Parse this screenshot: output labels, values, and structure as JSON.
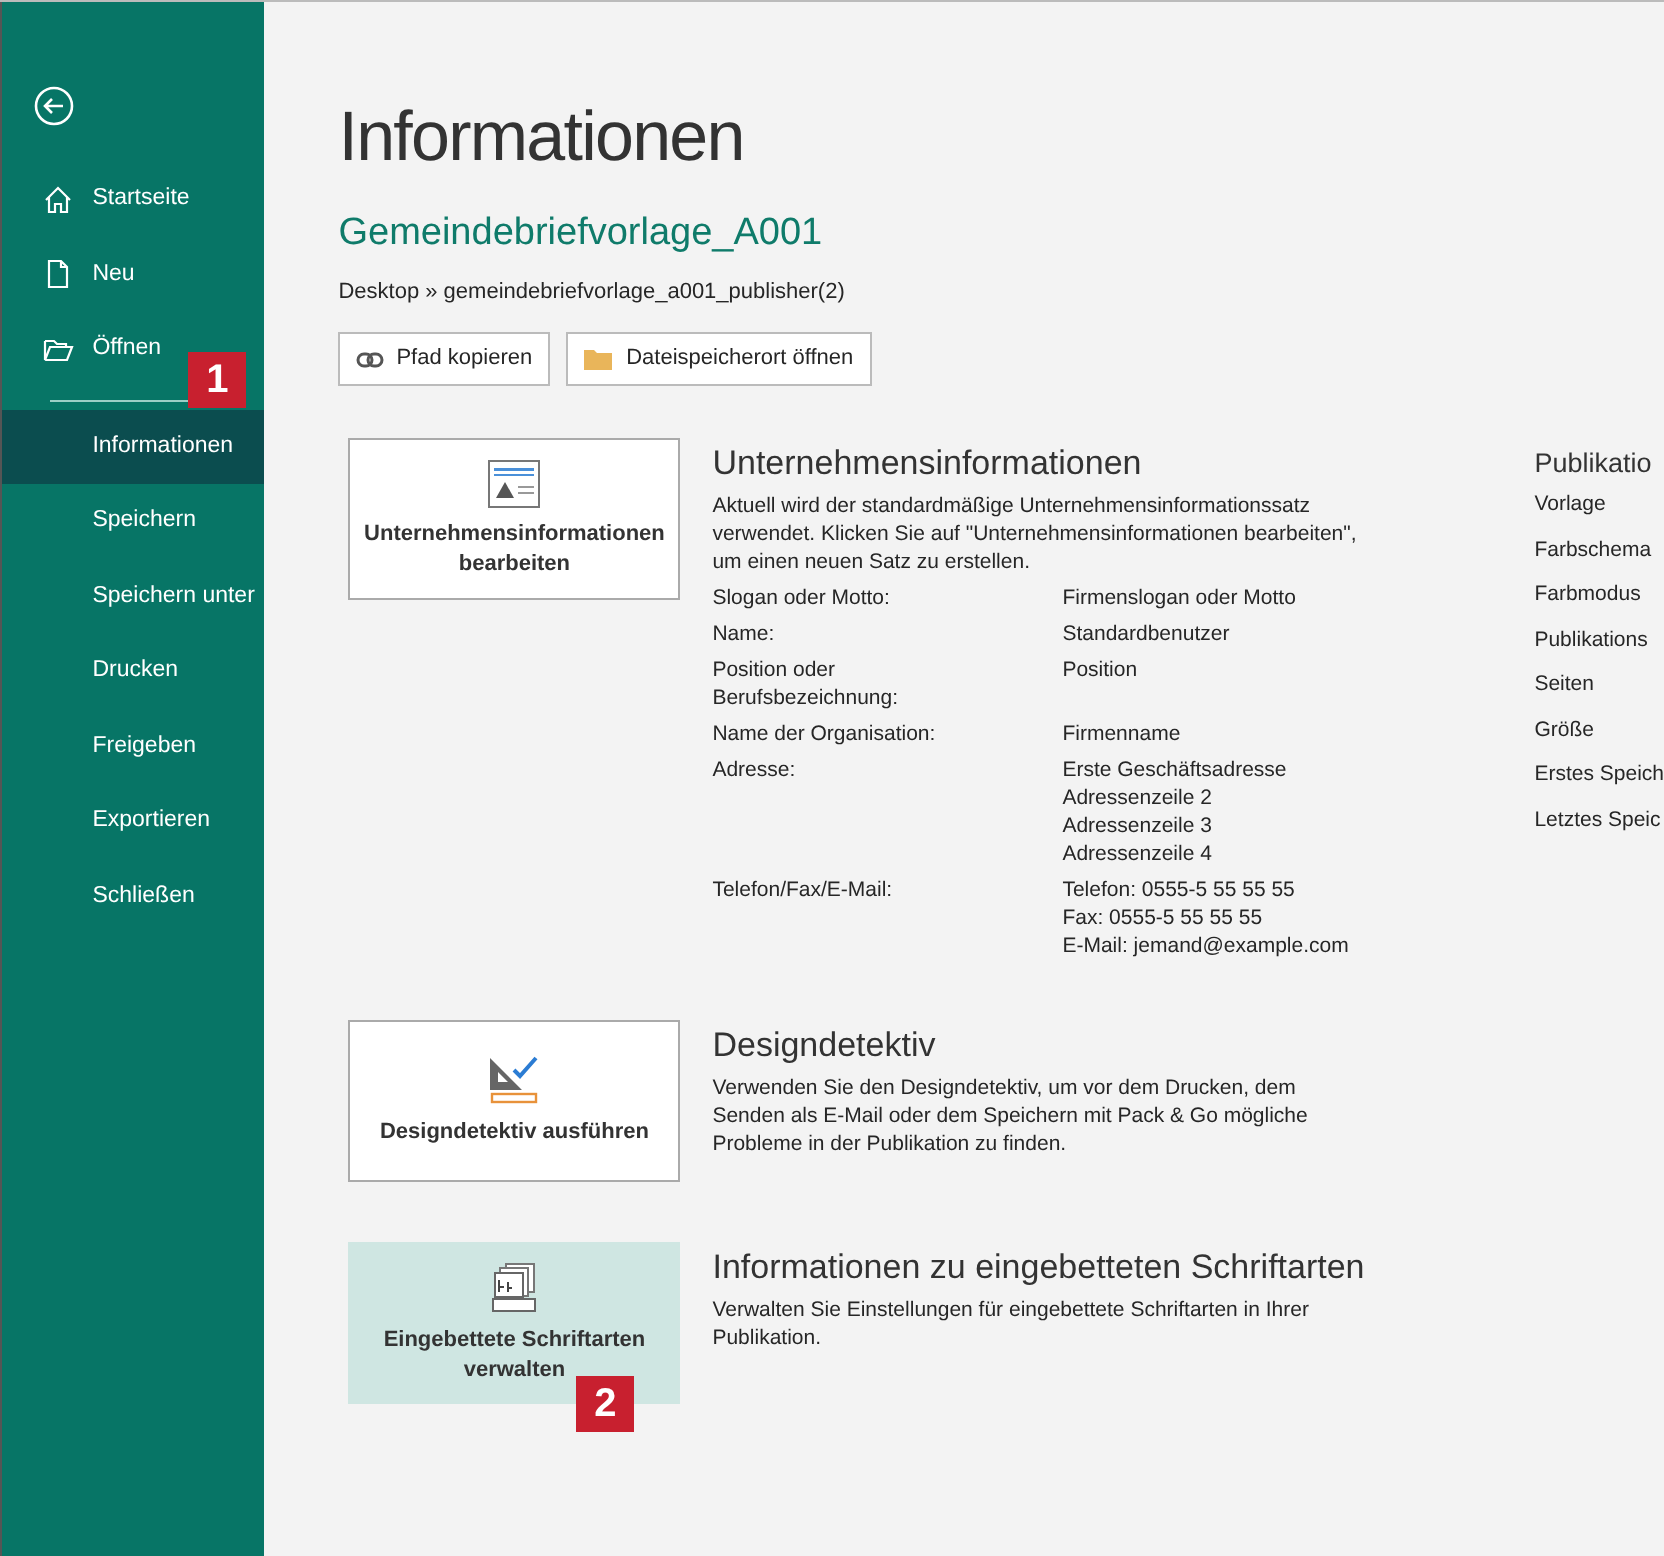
{
  "sidebar": {
    "items": [
      {
        "label": "Startseite",
        "selected": false
      },
      {
        "label": "Neu",
        "selected": false
      },
      {
        "label": "Öffnen",
        "selected": false
      },
      {
        "label": "Informationen",
        "selected": true,
        "badge": "1"
      },
      {
        "label": "Speichern",
        "selected": false
      },
      {
        "label": "Speichern unter",
        "selected": false
      },
      {
        "label": "Drucken",
        "selected": false
      },
      {
        "label": "Freigeben",
        "selected": false
      },
      {
        "label": "Exportieren",
        "selected": false
      },
      {
        "label": "Schließen",
        "selected": false
      }
    ]
  },
  "title": "Informationen",
  "document_name": "Gemeindebriefvorlage_A001",
  "path": "Desktop » gemeindebriefvorlage_a001_publisher(2)",
  "path_buttons": [
    {
      "label": "Pfad kopieren"
    },
    {
      "label": "Dateispeicherort öffnen"
    }
  ],
  "sections": [
    {
      "button": {
        "label": "Unternehmensinformationen bearbeiten",
        "highlighted": false
      },
      "heading": "Unternehmensinformationen",
      "description": "Aktuell wird der standardmäßige Unternehmensinformationssatz verwendet. Klicken Sie auf \"Unternehmensinformationen bearbeiten\", um einen neuen Satz zu erstellen.",
      "fields": [
        {
          "label": "Slogan oder Motto:",
          "values": [
            "Firmenslogan oder Motto"
          ]
        },
        {
          "label": "Name:",
          "values": [
            "Standardbenutzer"
          ]
        },
        {
          "label": "Position oder Berufsbezeichnung:",
          "values": [
            "Position"
          ]
        },
        {
          "label": "Name der Organisation:",
          "values": [
            "Firmenname"
          ]
        },
        {
          "label": "Adresse:",
          "values": [
            "Erste Geschäftsadresse",
            "Adressenzeile 2",
            "Adressenzeile 3",
            "Adressenzeile 4"
          ]
        },
        {
          "label": "Telefon/Fax/E-Mail:",
          "values": [
            "Telefon: 0555-5 55 55 55",
            "Fax: 0555-5 55 55 55",
            "E-Mail: jemand@example.com"
          ]
        }
      ]
    },
    {
      "button": {
        "label": "Designdetektiv ausführen",
        "highlighted": false
      },
      "heading": "Designdetektiv",
      "description": "Verwenden Sie den Designdetektiv, um vor dem Drucken, dem Senden als E-Mail oder dem Speichern mit Pack & Go mögliche Probleme in der Publikation zu finden."
    },
    {
      "button": {
        "label": "Eingebettete Schriftarten verwalten",
        "highlighted": true,
        "badge": "2"
      },
      "heading": "Informationen zu eingebetteten Schriftarten",
      "description": "Verwalten Sie Einstellungen für eingebettete Schriftarten in Ihrer Publikation."
    }
  ],
  "properties": {
    "heading": "Publikatio",
    "labels": [
      "Vorlage",
      "Farbschema",
      "Farbmodus",
      "Publikations",
      "Seiten",
      "Größe",
      "Erstes Speich",
      "Letztes Speic"
    ]
  }
}
